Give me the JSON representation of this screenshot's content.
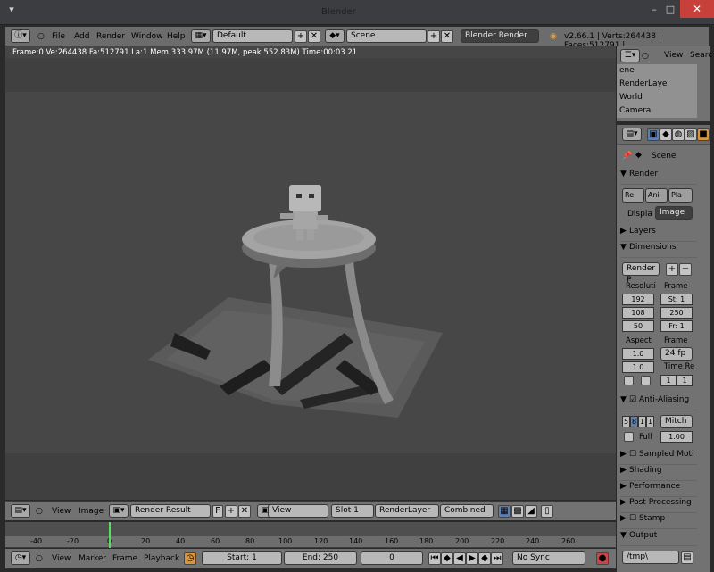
{
  "window": {
    "title": "Blender"
  },
  "info_header": {
    "menus": [
      "File",
      "Add",
      "Render",
      "Window",
      "Help"
    ],
    "screen_layout": "Default",
    "scene": "Scene",
    "render_engine": "Blender Render",
    "stats": "v2.66.1 | Verts:264438 | Faces:512791 | "
  },
  "render_info": "Frame:0 Ve:264438 Fa:512791 La:1 Mem:333.97M (11.97M, peak 552.83M) Time:00:03.21",
  "image_editor": {
    "menus": [
      "View",
      "Image"
    ],
    "image_name": "Render Result",
    "fake_user": "F",
    "view": "View",
    "slot": "Slot 1",
    "layer": "RenderLayer",
    "pass": "Combined"
  },
  "timeline": {
    "ruler": [
      "-40",
      "-20",
      "0",
      "20",
      "40",
      "60",
      "80",
      "100",
      "120",
      "140",
      "160",
      "180",
      "200",
      "220",
      "240",
      "260"
    ],
    "menus": [
      "View",
      "Marker",
      "Frame",
      "Playback"
    ],
    "start": "Start: 1",
    "end": "End: 250",
    "current": "0",
    "sync": "No Sync"
  },
  "outliner": {
    "menu": "View",
    "search": "Searc",
    "items": [
      "ene",
      "RenderLaye",
      "World",
      "Camera"
    ]
  },
  "properties": {
    "context": "Scene",
    "panels": {
      "render": "Render",
      "render_buttons": [
        "Re",
        "Ani",
        "Pla"
      ],
      "display_label": "Displa",
      "display_value": "Image",
      "layers": "Layers",
      "dimensions": "Dimensions",
      "preset": "Render P",
      "resolution_label": "Resoluti",
      "frame_label": "Frame",
      "res_x": "192",
      "res_y": "108",
      "res_pct": "50",
      "start": "St: 1",
      "end": "250",
      "step": "Fr: 1",
      "aspect_label": "Aspect",
      "frame_rate_label": "Frame",
      "aspect_x": "1.0",
      "aspect_y": "1.0",
      "fps": "24 fp",
      "time_remap": "Time Re",
      "remap_old": "1",
      "remap_new": "1",
      "anti_aliasing": "Anti-Aliasing",
      "aa_samples": [
        "5",
        "8",
        "1",
        "1"
      ],
      "aa_filter": "Mitch",
      "full_label": "Full",
      "filter_size": "1.00",
      "motion_blur": "Sampled Moti",
      "shading": "Shading",
      "performance": "Performance",
      "post": "Post Processing",
      "stamp": "Stamp",
      "output": "Output",
      "output_path": "/tmp\\"
    }
  }
}
